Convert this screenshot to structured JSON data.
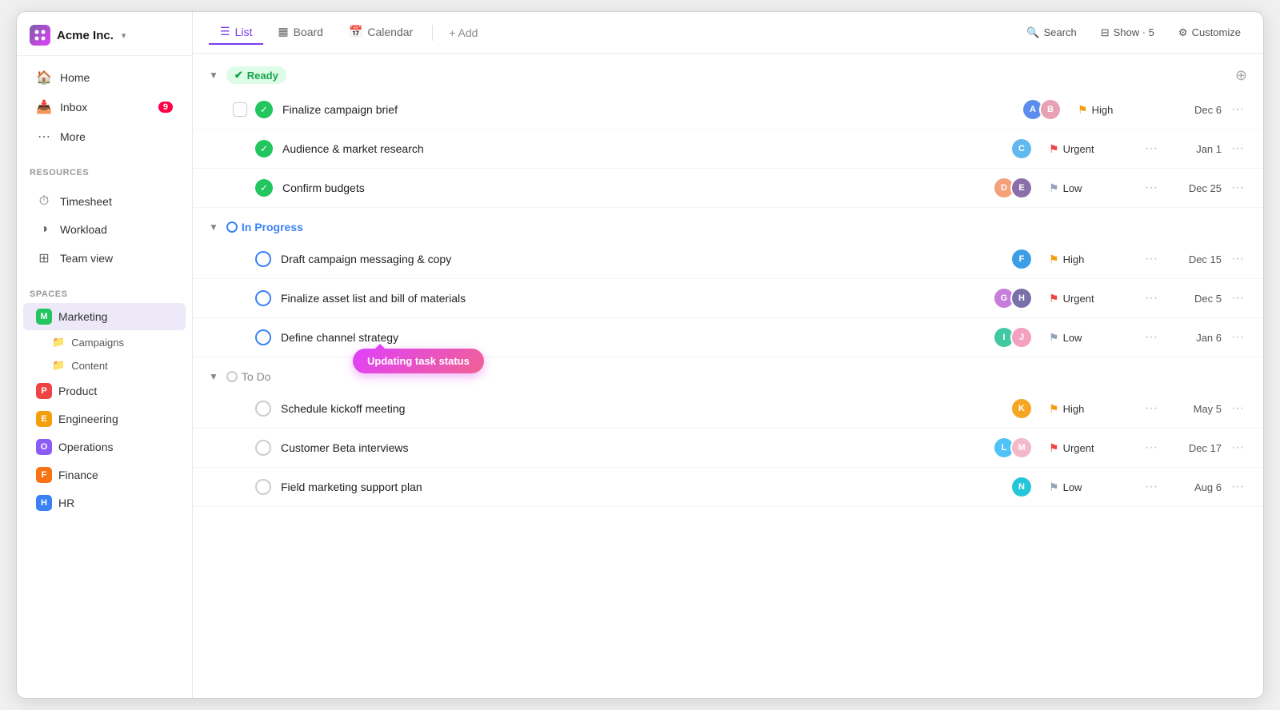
{
  "app": {
    "company": "Acme Inc.",
    "logo_alt": "acme-logo"
  },
  "sidebar": {
    "nav": [
      {
        "id": "home",
        "label": "Home",
        "icon": "🏠"
      },
      {
        "id": "inbox",
        "label": "Inbox",
        "icon": "📥",
        "badge": "9"
      },
      {
        "id": "more",
        "label": "More",
        "icon": "⋯"
      }
    ],
    "resources_label": "Resources",
    "resources": [
      {
        "id": "timesheet",
        "label": "Timesheet",
        "icon": "⏱"
      },
      {
        "id": "workload",
        "label": "Workload",
        "icon": "◑"
      },
      {
        "id": "teamview",
        "label": "Team view",
        "icon": "⊞"
      }
    ],
    "spaces_label": "Spaces",
    "spaces": [
      {
        "id": "marketing",
        "label": "Marketing",
        "color": "green",
        "letter": "M",
        "active": true,
        "children": [
          {
            "id": "campaigns",
            "label": "Campaigns"
          },
          {
            "id": "content",
            "label": "Content"
          }
        ]
      },
      {
        "id": "product",
        "label": "Product",
        "color": "red",
        "letter": "P"
      },
      {
        "id": "engineering",
        "label": "Engineering",
        "color": "yellow",
        "letter": "E"
      },
      {
        "id": "operations",
        "label": "Operations",
        "color": "purple",
        "letter": "O"
      },
      {
        "id": "finance",
        "label": "Finance",
        "color": "orange",
        "letter": "F"
      },
      {
        "id": "hr",
        "label": "HR",
        "color": "blue",
        "letter": "H"
      }
    ]
  },
  "topbar": {
    "tabs": [
      {
        "id": "list",
        "label": "List",
        "icon": "☰",
        "active": true
      },
      {
        "id": "board",
        "label": "Board",
        "icon": "▦"
      },
      {
        "id": "calendar",
        "label": "Calendar",
        "icon": "📅"
      }
    ],
    "add_label": "+ Add",
    "search_label": "Search",
    "show_label": "Show · 5",
    "customize_label": "Customize"
  },
  "groups": [
    {
      "id": "ready",
      "label": "Ready",
      "type": "ready",
      "tasks": [
        {
          "id": "t1",
          "name": "Finalize campaign brief",
          "status": "done",
          "avatars": [
            {
              "color": "#4f8ef7",
              "initials": "A"
            },
            {
              "color": "#e8a0b4",
              "initials": "B"
            }
          ],
          "priority": "High",
          "priority_level": "high",
          "due": "Dec 6",
          "show_checkbox": true
        },
        {
          "id": "t2",
          "name": "Audience & market research",
          "status": "done",
          "avatars": [
            {
              "color": "#60b8f0",
              "initials": "C"
            }
          ],
          "priority": "Urgent",
          "priority_level": "urgent",
          "due": "Jan 1"
        },
        {
          "id": "t3",
          "name": "Confirm budgets",
          "status": "done",
          "avatars": [
            {
              "color": "#f4a07a",
              "initials": "D"
            },
            {
              "color": "#8b6fa8",
              "initials": "E"
            }
          ],
          "priority": "Low",
          "priority_level": "low",
          "due": "Dec 25"
        }
      ]
    },
    {
      "id": "inprogress",
      "label": "In Progress",
      "type": "inprogress",
      "tasks": [
        {
          "id": "t4",
          "name": "Draft campaign messaging & copy",
          "status": "inprogress",
          "avatars": [
            {
              "color": "#3b9fe8",
              "initials": "F"
            }
          ],
          "priority": "High",
          "priority_level": "high",
          "due": "Dec 15"
        },
        {
          "id": "t5",
          "name": "Finalize asset list and bill of materials",
          "status": "inprogress",
          "avatars": [
            {
              "color": "#c77ddb",
              "initials": "G"
            },
            {
              "color": "#7a6fa8",
              "initials": "H"
            }
          ],
          "priority": "Urgent",
          "priority_level": "urgent",
          "due": "Dec 5"
        },
        {
          "id": "t6",
          "name": "Define channel strategy",
          "status": "inprogress",
          "avatars": [
            {
              "color": "#40c9a2",
              "initials": "I"
            },
            {
              "color": "#f4a0c0",
              "initials": "J"
            }
          ],
          "priority": "Low",
          "priority_level": "low",
          "due": "Jan 6",
          "show_tooltip": true,
          "tooltip_text": "Updating task status"
        }
      ]
    },
    {
      "id": "todo",
      "label": "To Do",
      "type": "todo",
      "tasks": [
        {
          "id": "t7",
          "name": "Schedule kickoff meeting",
          "status": "todo",
          "avatars": [
            {
              "color": "#f5a623",
              "initials": "K"
            }
          ],
          "priority": "High",
          "priority_level": "high",
          "due": "May 5"
        },
        {
          "id": "t8",
          "name": "Customer Beta interviews",
          "status": "todo",
          "avatars": [
            {
              "color": "#4fc3f7",
              "initials": "L"
            },
            {
              "color": "#f4b8c8",
              "initials": "M"
            }
          ],
          "priority": "Urgent",
          "priority_level": "urgent",
          "due": "Dec 17"
        },
        {
          "id": "t9",
          "name": "Field marketing support plan",
          "status": "todo",
          "avatars": [
            {
              "color": "#26c6da",
              "initials": "N"
            }
          ],
          "priority": "Low",
          "priority_level": "low",
          "due": "Aug 6"
        }
      ]
    }
  ]
}
